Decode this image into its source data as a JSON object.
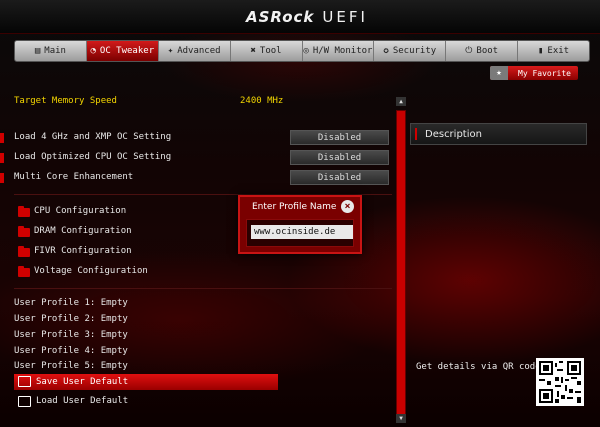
{
  "brand": {
    "logo": "ASRock",
    "suffix": "UEFI"
  },
  "nav": [
    {
      "label": "Main",
      "icon": "menu-icon"
    },
    {
      "label": "OC Tweaker",
      "icon": "gauge-icon"
    },
    {
      "label": "Advanced",
      "icon": "advanced-icon"
    },
    {
      "label": "Tool",
      "icon": "tool-icon"
    },
    {
      "label": "H/W Monitor",
      "icon": "monitor-icon"
    },
    {
      "label": "Security",
      "icon": "shield-icon"
    },
    {
      "label": "Boot",
      "icon": "power-icon"
    },
    {
      "label": "Exit",
      "icon": "exit-icon"
    }
  ],
  "favorite": {
    "label": "My Favorite"
  },
  "memory": {
    "label": "Target Memory Speed",
    "value": "2400 MHz"
  },
  "settings": [
    {
      "label": "Load 4 GHz and XMP OC Setting",
      "value": "Disabled"
    },
    {
      "label": "Load Optimized CPU OC Setting",
      "value": "Disabled"
    },
    {
      "label": "Multi Core Enhancement",
      "value": "Disabled"
    }
  ],
  "submenus": [
    "CPU Configuration",
    "DRAM Configuration",
    "FIVR Configuration",
    "Voltage Configuration"
  ],
  "profiles": [
    "User Profile 1: Empty",
    "User Profile 2: Empty",
    "User Profile 3: Empty",
    "User Profile 4: Empty",
    "User Profile 5: Empty"
  ],
  "actions": {
    "save": "Save User Default",
    "load": "Load User Default"
  },
  "description": {
    "title": "Description",
    "qr_text": "Get details via QR code"
  },
  "dialog": {
    "title": "Enter Profile Name",
    "input_value": "www.ocinside.de"
  },
  "colors": {
    "accent": "#d10000",
    "highlight": "#e01010",
    "value_yellow": "#f2d400"
  }
}
